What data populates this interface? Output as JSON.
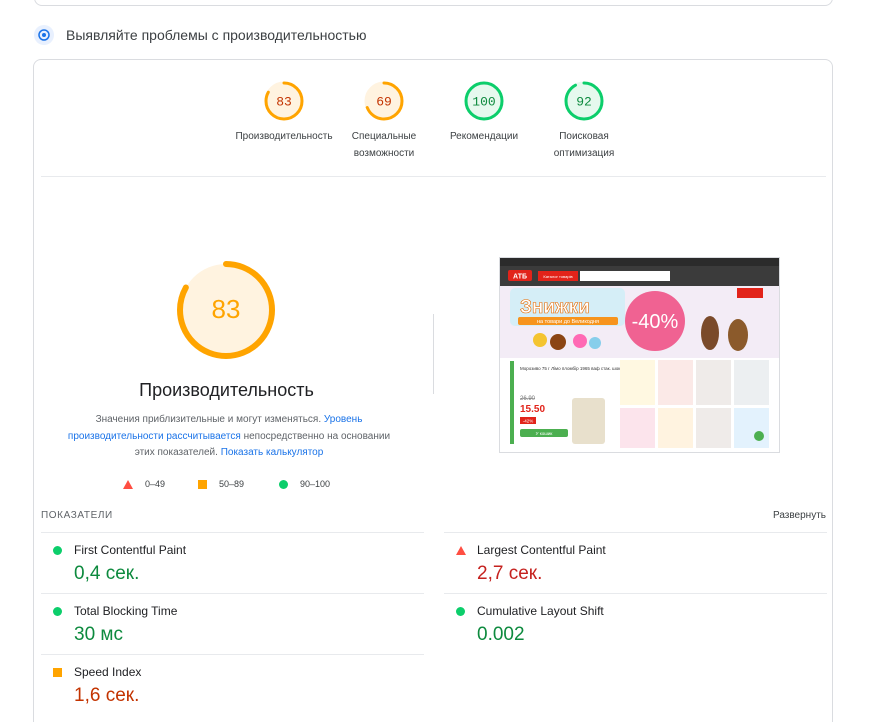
{
  "section": {
    "title": "Выявляйте проблемы с производительностью"
  },
  "categories": [
    {
      "score": "83",
      "label": "Производительность",
      "fraction": 0.83,
      "status": "average"
    },
    {
      "score": "69",
      "label": "Специальные возможности",
      "fraction": 0.69,
      "status": "average"
    },
    {
      "score": "100",
      "label": "Рекомендации",
      "fraction": 1.0,
      "status": "pass"
    },
    {
      "score": "92",
      "label": "Поисковая оптимизация",
      "fraction": 0.92,
      "status": "pass"
    }
  ],
  "main_gauge": {
    "score": "83",
    "fraction": 0.83,
    "title": "Производительность"
  },
  "description": {
    "part1": "Значения приблизительные и могут изменяться. ",
    "link1": "Уровень производительности рассчитывается",
    "part2": " непосредственно на основании этих показателей. ",
    "link2": "Показать калькулятор"
  },
  "legend": [
    {
      "range": "0–49",
      "shape": "triangle",
      "color": "#ff4e42"
    },
    {
      "range": "50–89",
      "shape": "square",
      "color": "#ffa400"
    },
    {
      "range": "90–100",
      "shape": "circle",
      "color": "#0cce6b"
    }
  ],
  "metrics_header": {
    "label": "ПОКАЗАТЕЛИ",
    "expand": "Развернуть"
  },
  "metrics": [
    {
      "name": "First Contentful Paint",
      "value": "0,4 сек.",
      "status": "pass"
    },
    {
      "name": "Largest Contentful Paint",
      "value": "2,7 сек.",
      "status": "fail"
    },
    {
      "name": "Total Blocking Time",
      "value": "30 мс",
      "status": "pass"
    },
    {
      "name": "Cumulative Layout Shift",
      "value": "0.002",
      "status": "pass"
    },
    {
      "name": "Speed Index",
      "value": "1,6 сек.",
      "status": "average"
    }
  ],
  "colors": {
    "pass": "#0cce6b",
    "average": "#ffa400",
    "fail": "#ff4e42",
    "link": "#1a73e8"
  },
  "screenshot": {
    "logo": "АТБ",
    "search_button": "Каталог товарів",
    "promo_title": "Знижки",
    "promo_subtitle": "на товари до Великодня",
    "promo_badge": "-40%",
    "product_name": "Морозиво 75 г Лімо пломбір 1965 ваф стак. шок.",
    "old_price": "26.90",
    "new_price": "15.50",
    "discount": "-42%",
    "cart_button": "У кошик"
  }
}
